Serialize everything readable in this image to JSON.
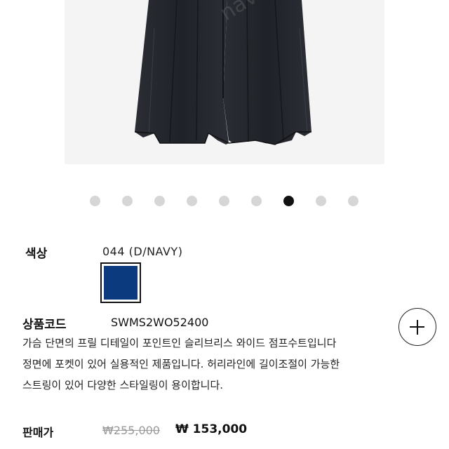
{
  "product_image": {
    "alt": "product photo",
    "watermark": "naver.co"
  },
  "carousel": {
    "count": 9,
    "active_index": 6
  },
  "color": {
    "label": "색상",
    "value": "044 (D/NAVY)",
    "swatch_hex": "#0b3a7e"
  },
  "product_code": {
    "label": "상품코드",
    "value": "SWMS2WO52400"
  },
  "description": [
    "가슴 단면의 프릴 디테일이 포인트인 슬리브리스 와이드 점프수트입니다",
    "정면에 포켓이 있어 실용적인 제품입니다. 허리라인에 길이조절이 가능한",
    "스트링이 있어 다양한 스타일링이 용이합니다."
  ],
  "price": {
    "label": "판매가",
    "original": "₩255,000",
    "sale": "₩ 153,000"
  },
  "add_button": {
    "icon": "plus-icon"
  }
}
